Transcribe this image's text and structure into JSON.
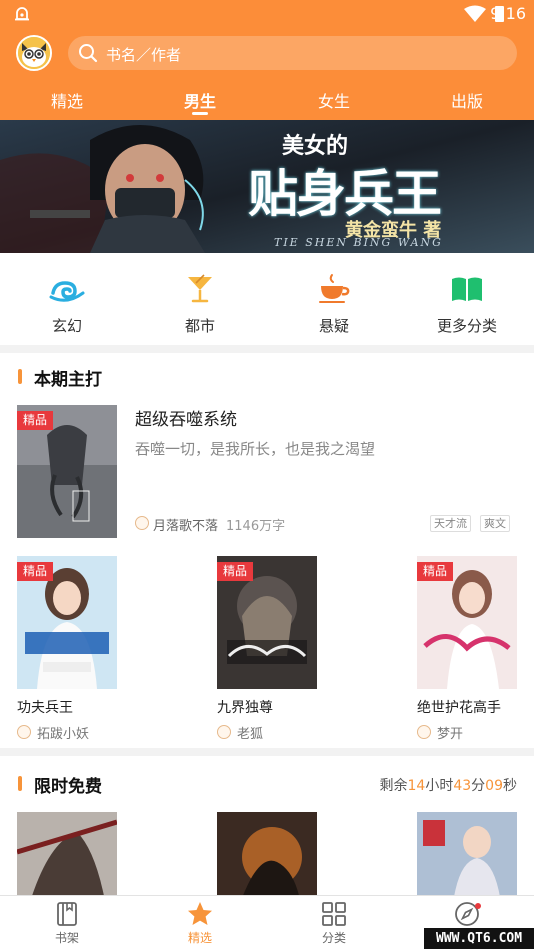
{
  "status_bar": {
    "time": "9:16"
  },
  "search": {
    "placeholder": "书名／作者"
  },
  "tabs": [
    {
      "label": "精选"
    },
    {
      "label": "男生"
    },
    {
      "label": "女生"
    },
    {
      "label": "出版"
    }
  ],
  "active_tab": "男生",
  "banner": {
    "title_line1": "美女的",
    "title_line2": "贴身兵王",
    "author": "黄金蛮牛 著",
    "pinyin": "TIE SHEN BING WANG"
  },
  "categories": [
    {
      "label": "玄幻",
      "icon": "wave-cloud-icon"
    },
    {
      "label": "都市",
      "icon": "cocktail-icon"
    },
    {
      "label": "悬疑",
      "icon": "coffee-cup-icon"
    },
    {
      "label": "更多分类",
      "icon": "open-book-icon"
    }
  ],
  "section_featured": {
    "title": "本期主打",
    "badge": "精品",
    "featured": {
      "title": "超级吞噬系统",
      "description": "吞噬一切，是我所长，也是我之渴望",
      "author": "月落歌不落",
      "words": "1146万字",
      "tags": [
        "天才流",
        "爽文"
      ]
    },
    "books": [
      {
        "title": "功夫兵王",
        "author": "拓跋小妖",
        "badge": "精品"
      },
      {
        "title": "九界独尊",
        "author": "老狐",
        "badge": "精品"
      },
      {
        "title": "绝世护花高手",
        "author": "梦开",
        "badge": "精品"
      }
    ]
  },
  "section_free": {
    "title": "限时免费",
    "countdown": {
      "prefix": "剩余",
      "hours": "14",
      "hours_unit": "小时",
      "minutes": "43",
      "minutes_unit": "分",
      "seconds": "09",
      "seconds_unit": "秒"
    }
  },
  "bottom_nav": [
    {
      "label": "书架",
      "icon": "bookshelf-icon"
    },
    {
      "label": "精选",
      "icon": "star-icon"
    },
    {
      "label": "分类",
      "icon": "grid-icon"
    },
    {
      "label": "",
      "icon": "compass-icon"
    }
  ],
  "watermark": "WWW.QT6.COM",
  "colors": {
    "accent": "#fc8d39",
    "badge_red": "#e8393d",
    "highlight": "#f7943a"
  }
}
